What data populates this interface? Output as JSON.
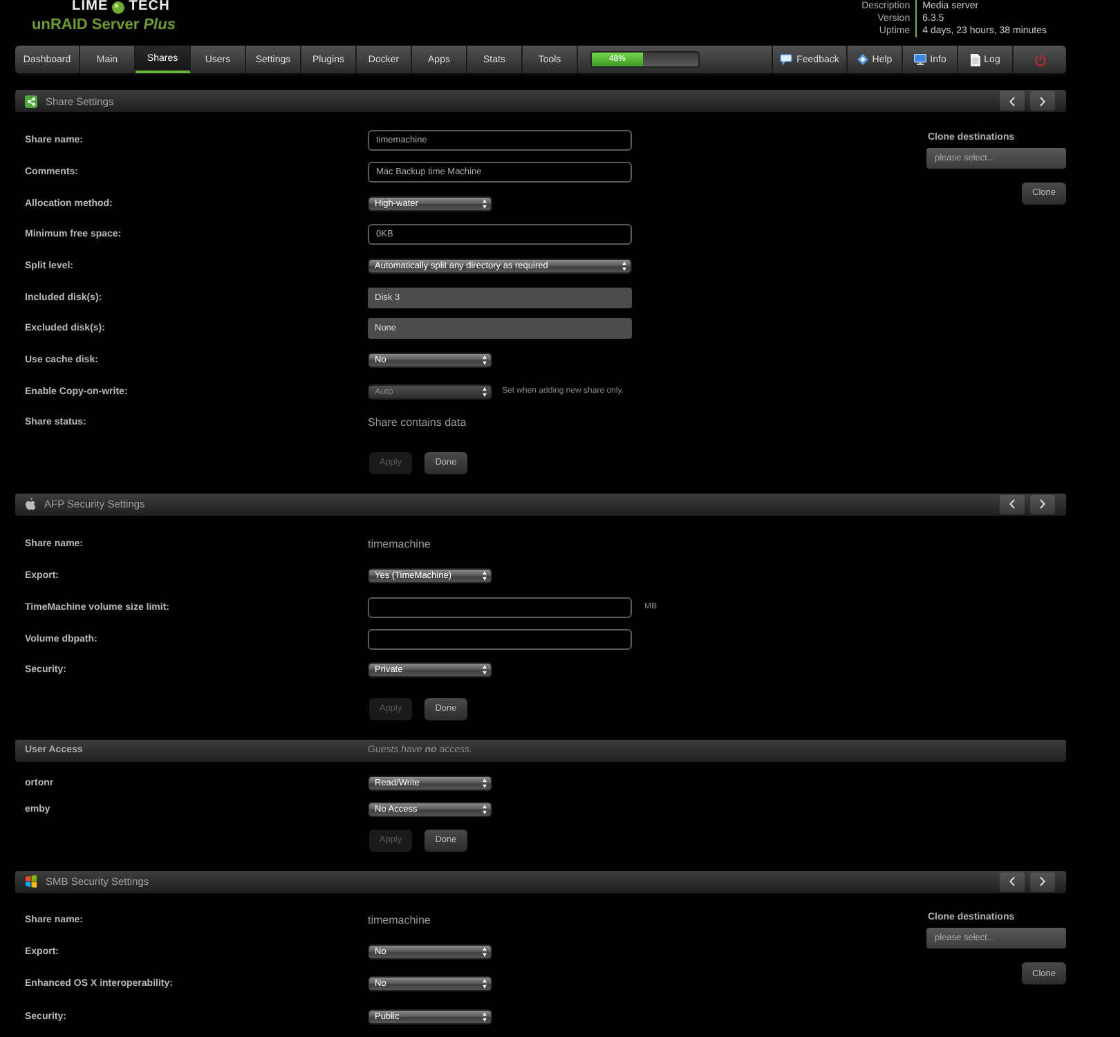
{
  "header": {
    "logo": {
      "left": "LIME",
      "right": "TECH",
      "product": "unRAID Server *Plus*"
    },
    "info": [
      {
        "label": "Description",
        "value": "Media server"
      },
      {
        "label": "Version",
        "value": "6.3.5"
      },
      {
        "label": "Uptime",
        "value": "4 days, 23 hours, 38 minutes"
      }
    ]
  },
  "nav": {
    "tabs": [
      {
        "label": "Dashboard",
        "selected": false
      },
      {
        "label": "Main",
        "selected": false
      },
      {
        "label": "Shares",
        "selected": true
      },
      {
        "label": "Users",
        "selected": false
      },
      {
        "label": "Settings",
        "selected": false
      },
      {
        "label": "Plugins",
        "selected": false
      },
      {
        "label": "Docker",
        "selected": false
      },
      {
        "label": "Apps",
        "selected": false
      },
      {
        "label": "Stats",
        "selected": false
      },
      {
        "label": "Tools",
        "selected": false
      }
    ],
    "progress": {
      "level": 0.48,
      "reading": "48%"
    },
    "links": [
      {
        "kind": "feedback",
        "label": "Feedback"
      },
      {
        "kind": "help",
        "label": "Help"
      },
      {
        "kind": "info",
        "label": "Info"
      },
      {
        "kind": "log",
        "label": "Log"
      },
      {
        "kind": "power"
      }
    ]
  },
  "share_settings": {
    "title": "Share Settings",
    "fields": [
      {
        "label": "Share name:",
        "kind": "input",
        "value": "timemachine",
        "disabled": false
      },
      {
        "label": "Comments:",
        "kind": "input",
        "value": "Mac Backup time Machine",
        "disabled": false
      },
      {
        "label": "Allocation method:",
        "kind": "select",
        "value": "High-water",
        "disabled": false
      },
      {
        "label": "Minimum free space:",
        "kind": "input",
        "value": "0KB",
        "disabled": false
      },
      {
        "label": "Split level:",
        "kind": "select_wide",
        "value": "Automatically split any directory as required",
        "disabled": false
      },
      {
        "label": "Included disk(s):",
        "kind": "multiselect",
        "value": "Disk 3",
        "disabled": false
      },
      {
        "label": "Excluded disk(s):",
        "kind": "multiselect",
        "value": "None",
        "disabled": false
      },
      {
        "label": "Use cache disk:",
        "kind": "select",
        "value": "No",
        "disabled": false
      },
      {
        "label": "Enable Copy-on-write:",
        "kind": "select",
        "value": "Auto",
        "disabled": true,
        "note": "Set when adding new share only."
      },
      {
        "label": "Share status:",
        "kind": "text",
        "value": "Share contains data",
        "disabled": false
      }
    ],
    "buttons": [
      {
        "label": "Apply",
        "disabled": true
      },
      {
        "label": "Done",
        "disabled": false
      }
    ],
    "clone": {
      "label": "Clone destinations",
      "value": "please select...",
      "button": "Clone"
    }
  },
  "afp_security": {
    "title": "AFP Security Settings",
    "fields": [
      {
        "label": "Share name:",
        "kind": "text",
        "value": "timemachine"
      },
      {
        "label": "Export:",
        "kind": "select",
        "value": "Yes (TimeMachine)"
      },
      {
        "label": "TimeMachine volume size limit:",
        "kind": "input",
        "unit": "MB"
      },
      {
        "label": "Volume dbpath:",
        "kind": "input"
      },
      {
        "label": "Security:",
        "kind": "select",
        "value": "Private"
      }
    ],
    "buttons": [
      {
        "label": "Apply",
        "disabled": true
      },
      {
        "label": "Done",
        "disabled": false
      }
    ]
  },
  "user_access": {
    "title": "User Access",
    "note": "Guests have **no** access.",
    "users": [
      {
        "name": "ortonr",
        "value": "Read/Write"
      },
      {
        "name": "emby",
        "value": "No Access"
      }
    ],
    "buttons": [
      {
        "label": "Apply",
        "disabled": true
      },
      {
        "label": "Done",
        "disabled": false
      }
    ]
  },
  "smb_security": {
    "title": "SMB Security Settings",
    "fields": [
      {
        "label": "Share name:",
        "kind": "text",
        "value": "timemachine"
      },
      {
        "label": "Export:",
        "kind": "select",
        "value": "No"
      },
      {
        "label": "Enhanced OS X interoperability:",
        "kind": "select",
        "value": "No"
      },
      {
        "label": "Security:",
        "kind": "select",
        "value": "Public"
      }
    ],
    "clone": {
      "label": "Clone destinations",
      "value": "please select...",
      "button": "Clone"
    }
  }
}
